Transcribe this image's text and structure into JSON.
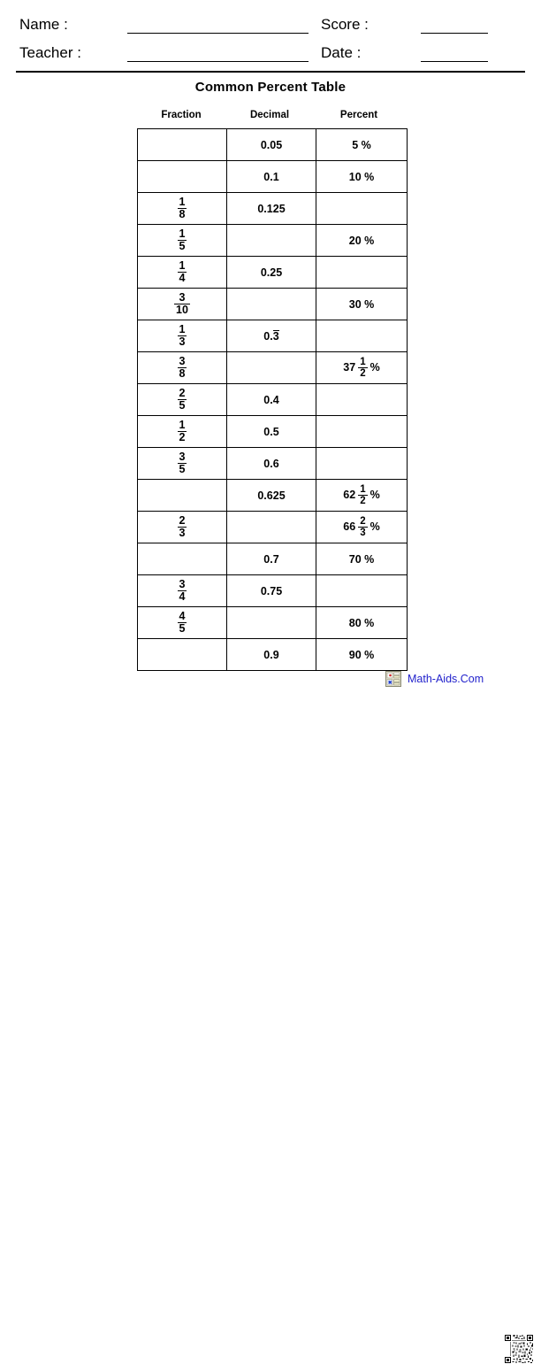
{
  "header": {
    "name_label": "Name :",
    "teacher_label": "Teacher :",
    "score_label": "Score :",
    "date_label": "Date :",
    "name_value": "",
    "teacher_value": "",
    "score_value": "",
    "date_value": ""
  },
  "title": "Common Percent Table",
  "title_color": "#2222cc",
  "table": {
    "columns": [
      "Fraction",
      "Decimal",
      "Percent"
    ],
    "rows": [
      {
        "fraction": null,
        "decimal": "0.05",
        "percent": "5 %"
      },
      {
        "fraction": null,
        "decimal": "0.1",
        "percent": "10 %"
      },
      {
        "fraction": {
          "num": "1",
          "den": "8"
        },
        "decimal": "0.125",
        "percent": null
      },
      {
        "fraction": {
          "num": "1",
          "den": "5"
        },
        "decimal": null,
        "percent": "20 %"
      },
      {
        "fraction": {
          "num": "1",
          "den": "4"
        },
        "decimal": "0.25",
        "percent": null
      },
      {
        "fraction": {
          "num": "3",
          "den": "10"
        },
        "decimal": null,
        "percent": "30 %"
      },
      {
        "fraction": {
          "num": "1",
          "den": "3"
        },
        "decimal_repeating": {
          "prefix": "0.",
          "repeat": "3"
        },
        "percent": null
      },
      {
        "fraction": {
          "num": "3",
          "den": "8"
        },
        "decimal": null,
        "percent_mixed": {
          "whole": "37",
          "num": "1",
          "den": "2",
          "symbol": "%"
        }
      },
      {
        "fraction": {
          "num": "2",
          "den": "5"
        },
        "decimal": "0.4",
        "percent": null
      },
      {
        "fraction": {
          "num": "1",
          "den": "2"
        },
        "decimal": "0.5",
        "percent": null
      },
      {
        "fraction": {
          "num": "3",
          "den": "5"
        },
        "decimal": "0.6",
        "percent": null
      },
      {
        "fraction": null,
        "decimal": "0.625",
        "percent_mixed": {
          "whole": "62",
          "num": "1",
          "den": "2",
          "symbol": "%"
        }
      },
      {
        "fraction": {
          "num": "2",
          "den": "3"
        },
        "decimal": null,
        "percent_mixed": {
          "whole": "66",
          "num": "2",
          "den": "3",
          "symbol": "%"
        }
      },
      {
        "fraction": null,
        "decimal": "0.7",
        "percent": "70 %"
      },
      {
        "fraction": {
          "num": "3",
          "den": "4"
        },
        "decimal": "0.75",
        "percent": null
      },
      {
        "fraction": {
          "num": "4",
          "den": "5"
        },
        "decimal": null,
        "percent": "80 %"
      },
      {
        "fraction": null,
        "decimal": "0.9",
        "percent": "90 %"
      }
    ]
  },
  "footer": {
    "brand_text": "Math-Aids.Com",
    "brand_color": "#2222cc",
    "logo_icon": "calculator-icon",
    "qr_icon": "qr-code"
  }
}
